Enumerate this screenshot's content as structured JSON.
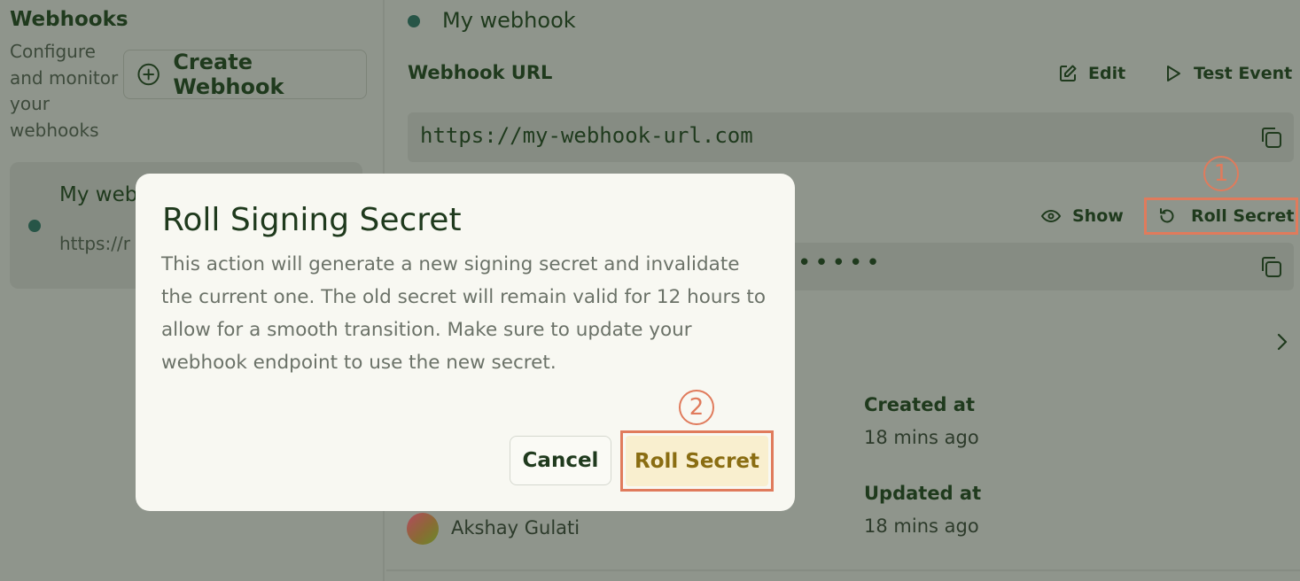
{
  "sidebar": {
    "title": "Webhooks",
    "description": "Configure and monitor your webhooks",
    "create_button": "Create Webhook",
    "webhook_item": {
      "name": "My web",
      "url": "https://r"
    }
  },
  "main": {
    "title": "My webhook",
    "url_label": "Webhook URL",
    "edit_label": "Edit",
    "test_event_label": "Test Event",
    "url_value": "https://my-webhook-url.com",
    "show_label": "Show",
    "roll_secret_label": "Roll Secret",
    "secret_masked": "•••••",
    "created_label": "Created at",
    "created_value": "18 mins ago",
    "updated_label": "Updated at",
    "updated_value": "18 mins ago",
    "author": "Akshay Gulati"
  },
  "modal": {
    "title": "Roll Signing Secret",
    "body": "This action will generate a new signing secret and invalidate the current one. The old secret will remain valid for 12 hours to allow for a smooth transition. Make sure to update your webhook endpoint to use the new secret.",
    "cancel_label": "Cancel",
    "confirm_label": "Roll Secret"
  },
  "annotations": {
    "step1": "1",
    "step2": "2"
  },
  "colors": {
    "accent": "#e07b5c",
    "status_dot": "#275547",
    "confirm_bg": "#f9efcf"
  }
}
